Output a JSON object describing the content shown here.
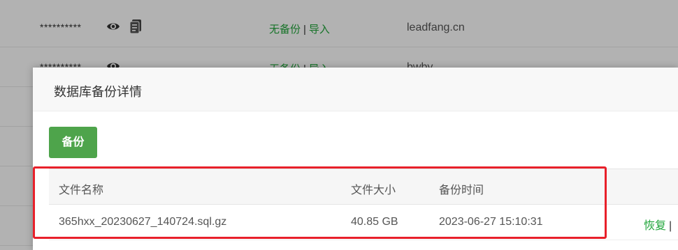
{
  "background_table": {
    "rows": [
      {
        "password": "**********",
        "backup_status": "无备份",
        "separator": "|",
        "import_link": "导入",
        "db_name": "leadfang.cn"
      },
      {
        "password": "**********",
        "backup_status": "无备份",
        "separator": "|",
        "import_link": "导入",
        "db_name": "bwby"
      }
    ]
  },
  "modal": {
    "title": "数据库备份详情",
    "backup_button": "备份",
    "table": {
      "headers": {
        "name": "文件名称",
        "size": "文件大小",
        "time": "备份时间"
      },
      "rows": [
        {
          "name": "365hxx_20230627_140724.sql.gz",
          "size": "40.85 GB",
          "time": "2023-06-27 15:10:31",
          "restore": "恢复",
          "separator": "|"
        }
      ]
    }
  },
  "colors": {
    "accent_green": "#20a53a",
    "button_green": "#4ea44b",
    "highlight_red": "#e8202a"
  },
  "icons": {
    "view": "eye-icon",
    "copy": "clipboard-icon"
  }
}
